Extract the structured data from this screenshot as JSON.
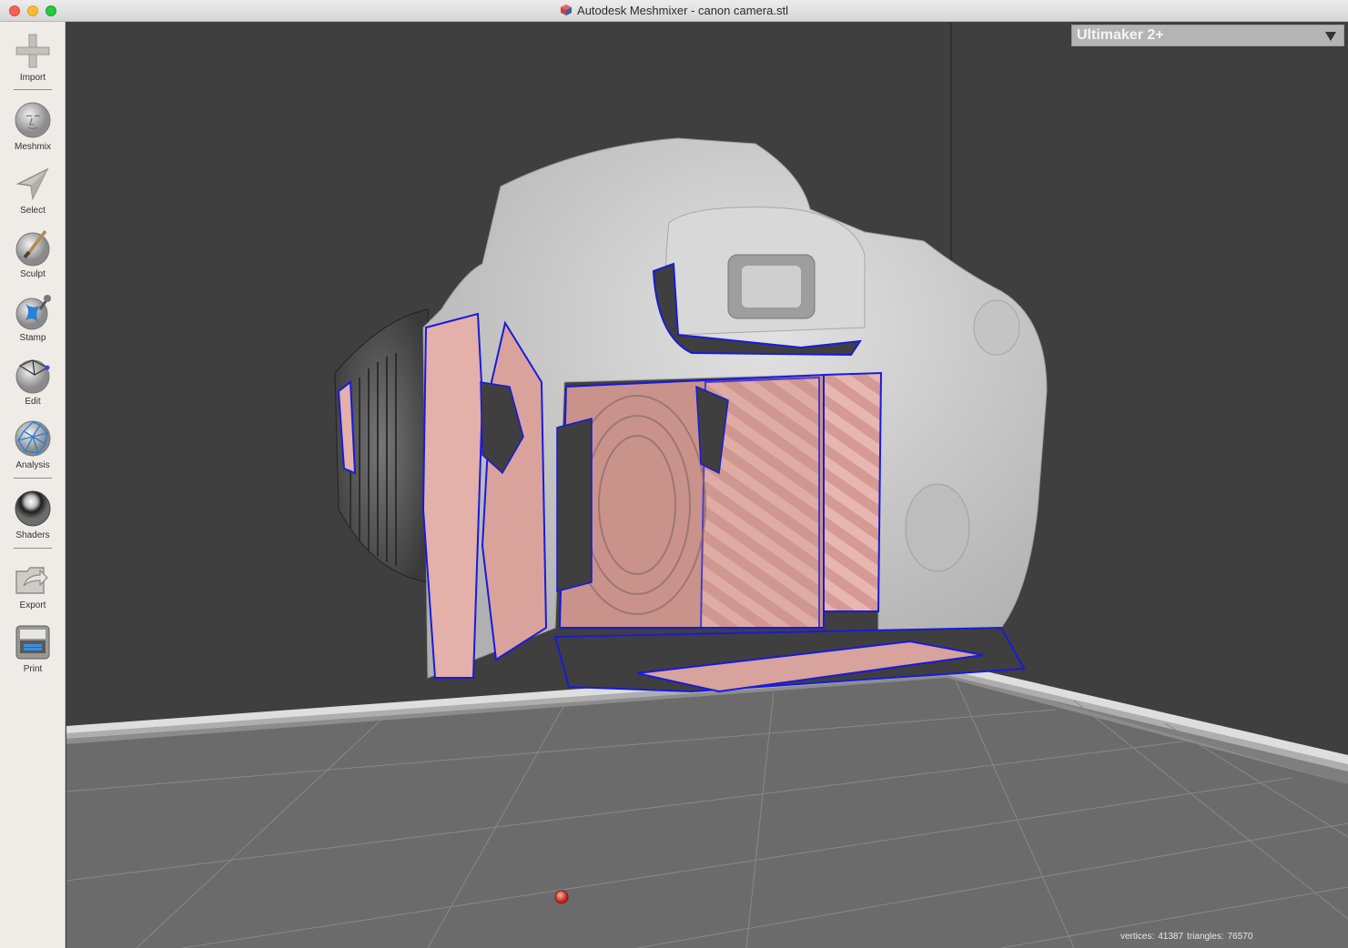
{
  "window": {
    "app_name": "Autodesk Meshmixer",
    "title": "Autodesk Meshmixer - canon camera.stl"
  },
  "toolbar": {
    "items": [
      {
        "label": "Import",
        "icon": "plus-icon"
      },
      {
        "label": "Meshmix",
        "icon": "meshmix-face-icon"
      },
      {
        "label": "Select",
        "icon": "select-arrow-icon"
      },
      {
        "label": "Sculpt",
        "icon": "sculpt-brush-icon"
      },
      {
        "label": "Stamp",
        "icon": "stamp-icon"
      },
      {
        "label": "Edit",
        "icon": "edit-mesh-icon"
      },
      {
        "label": "Analysis",
        "icon": "analysis-sphere-icon"
      },
      {
        "label": "Shaders",
        "icon": "shader-sphere-icon"
      },
      {
        "label": "Export",
        "icon": "export-icon"
      },
      {
        "label": "Print",
        "icon": "printer-icon"
      }
    ]
  },
  "printer_select": {
    "value": "Ultimaker 2+"
  },
  "status": {
    "vertices_label": "vertices:",
    "vertices": "41387",
    "triangles_label": "triangles:",
    "triangles": "76570"
  },
  "colors": {
    "viewport_bg": "#3f3f3f",
    "build_plate": "#6b6b6b",
    "mesh": "#c9c9c9",
    "selection_fill": "#e3b0aa",
    "selection_outline": "#1a1adc",
    "pivot": "#e04a3a"
  }
}
